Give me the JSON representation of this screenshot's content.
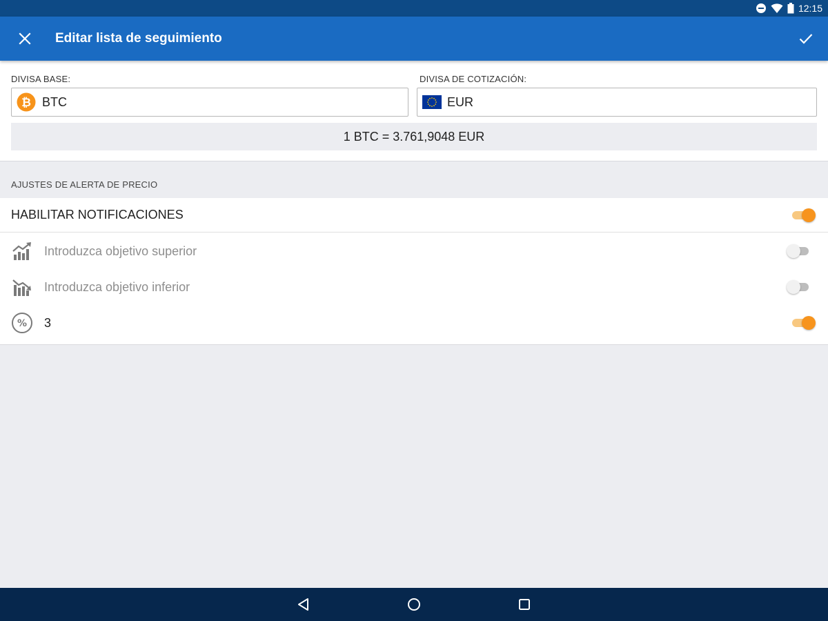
{
  "status_bar": {
    "time": "12:15",
    "icons": [
      "do-not-disturb-icon",
      "wifi-icon",
      "battery-icon"
    ]
  },
  "app_bar": {
    "title": "Editar lista de seguimiento",
    "close_icon": "close-icon",
    "confirm_icon": "check-icon"
  },
  "currency": {
    "base_label": "DIVISA BASE:",
    "base_value": "BTC",
    "base_icon": "bitcoin-icon",
    "quote_label": "DIVISA DE COTIZACIÓN:",
    "quote_value": "EUR",
    "quote_icon": "eu-flag-icon",
    "rate_text": "1 BTC = 3.761,9048 EUR"
  },
  "alerts": {
    "section_title": "AJUSTES DE ALERTA DE PRECIO",
    "enable_label": "HABILITAR NOTIFICACIONES",
    "enable_on": true,
    "upper_placeholder": "Introduzca objetivo superior",
    "upper_icon": "chart-up-icon",
    "upper_on": false,
    "lower_placeholder": "Introduzca objetivo inferior",
    "lower_icon": "chart-down-icon",
    "lower_on": false,
    "percent_value": "3",
    "percent_icon": "percent-icon",
    "percent_on": true
  },
  "colors": {
    "status_bar": "#0d4a86",
    "app_bar": "#1a6bc2",
    "accent": "#f7941d",
    "nav_bar": "#06274d",
    "background": "#ecedf1"
  },
  "nav": {
    "icons": [
      "back-triangle-icon",
      "home-circle-icon",
      "recents-square-icon"
    ]
  }
}
